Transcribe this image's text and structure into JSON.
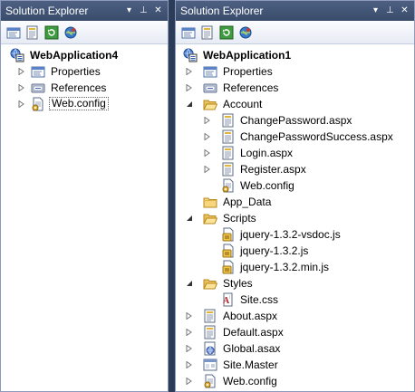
{
  "left_panel": {
    "title": "Solution Explorer",
    "title_buttons": [
      "▾",
      "⊥",
      "✕"
    ],
    "root": "WebApplication4",
    "items": [
      {
        "label": "Properties"
      },
      {
        "label": "References"
      },
      {
        "label": "Web.config"
      }
    ]
  },
  "right_panel": {
    "title": "Solution Explorer",
    "title_buttons": [
      "▾",
      "⊥",
      "✕"
    ],
    "root": "WebApplication1",
    "items": [
      {
        "label": "Properties"
      },
      {
        "label": "References"
      },
      {
        "label": "Account"
      },
      {
        "label": "ChangePassword.aspx"
      },
      {
        "label": "ChangePasswordSuccess.aspx"
      },
      {
        "label": "Login.aspx"
      },
      {
        "label": "Register.aspx"
      },
      {
        "label": "Web.config"
      },
      {
        "label": "App_Data"
      },
      {
        "label": "Scripts"
      },
      {
        "label": "jquery-1.3.2-vsdoc.js"
      },
      {
        "label": "jquery-1.3.2.js"
      },
      {
        "label": "jquery-1.3.2.min.js"
      },
      {
        "label": "Styles"
      },
      {
        "label": "Site.css"
      },
      {
        "label": "About.aspx"
      },
      {
        "label": "Default.aspx"
      },
      {
        "label": "Global.asax"
      },
      {
        "label": "Site.Master"
      },
      {
        "label": "Web.config"
      }
    ]
  }
}
